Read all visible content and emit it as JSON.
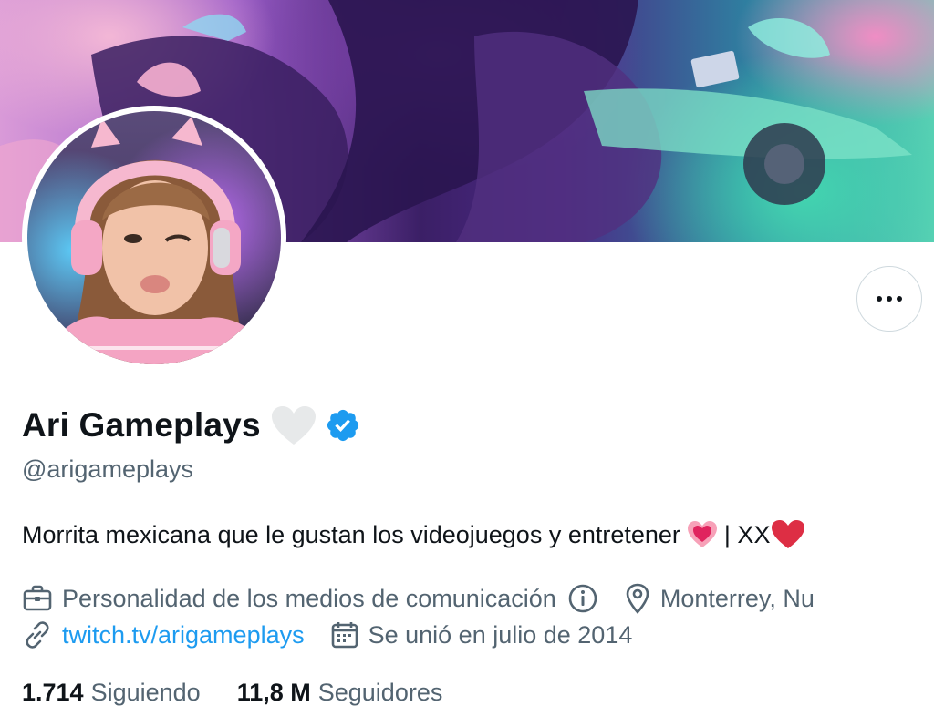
{
  "profile": {
    "display_name": "Ari Gameplays",
    "handle": "@arigameplays",
    "bio_text": "Morrita mexicana que le gustan los videojuegos y entretener",
    "bio_separator": "| XX",
    "category": "Personalidad de los medios de comunicación",
    "location": "Monterrey, Nu",
    "website": "twitch.tv/arigameplays",
    "joined": "Se unió en julio de 2014"
  },
  "stats": {
    "following_count": "1.714",
    "following_label": "Siguiendo",
    "followers_count": "11,8 M",
    "followers_label": "Seguidores"
  },
  "icons": {
    "more": "more-horizontal-icon",
    "verified": "verified-badge-icon",
    "heart": "white-heart-icon",
    "category": "briefcase-icon",
    "info": "info-icon",
    "location": "location-pin-icon",
    "link": "link-icon",
    "calendar": "calendar-icon"
  },
  "colors": {
    "accent": "#1d9bf0",
    "secondary_text": "#536471",
    "primary_text": "#0f1419"
  }
}
